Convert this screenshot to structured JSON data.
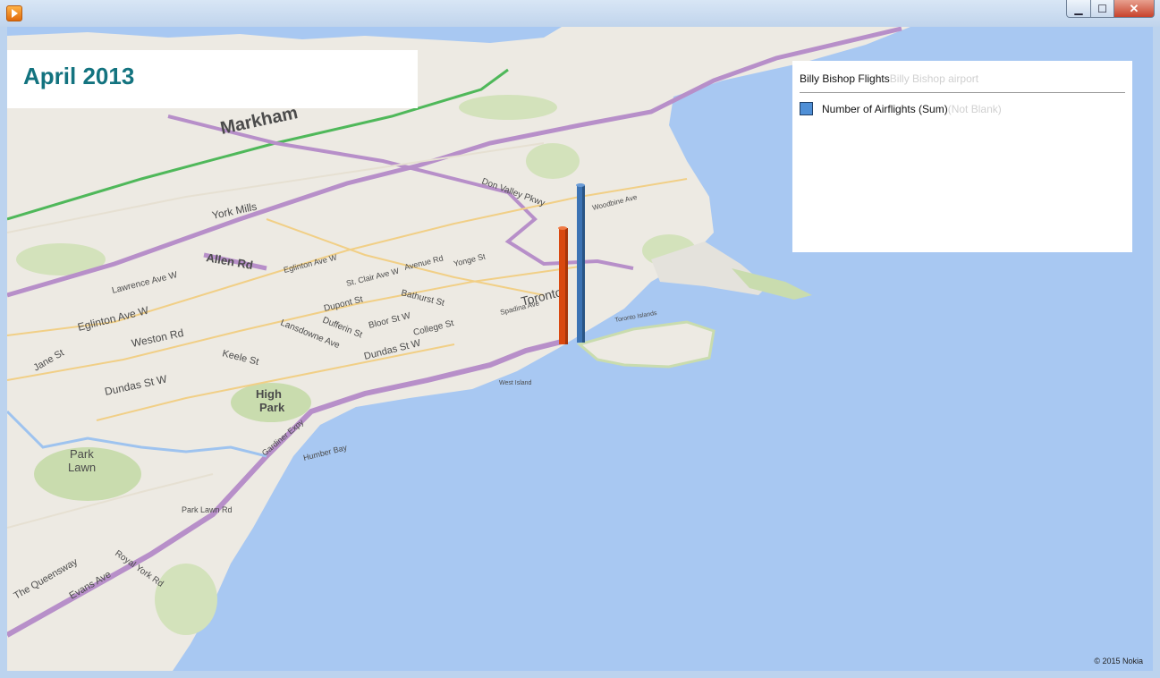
{
  "window": {
    "controls": {
      "minimize": "▁",
      "maximize": "☐",
      "close": "✕"
    }
  },
  "tour": {
    "title": "April 2013"
  },
  "legend": {
    "layer_name": "Billy Bishop Flights",
    "layer_ghost": "Billy Bishop airport",
    "items": [
      {
        "label": "Number of Airflights (Sum)",
        "ghost": "(Not Blank)",
        "color": "#4f8fd6"
      }
    ]
  },
  "map": {
    "copyright": "© 2015 Nokia",
    "colors": {
      "water": "#a8c8f2",
      "land": "#edeae3",
      "park": "#c9dcae",
      "highway": "#b78fc9",
      "arterial": "#f1cf86",
      "green_route": "#4fb85a"
    },
    "bars": [
      {
        "series": "orange",
        "color": "#d9480f"
      },
      {
        "series": "blue",
        "color": "#3c73b4"
      }
    ],
    "labels": {
      "markham": "Markham",
      "york_mills": "York Mills",
      "allen": "Allen Rd",
      "lawrence": "Lawrence Ave W",
      "eglinton_w": "Eglinton Ave W",
      "eglinton_e": "Eglinton Ave W",
      "weston": "Weston Rd",
      "keele": "Keele St",
      "jane": "Jane St",
      "dundas_w": "Dundas St W",
      "dundas_c": "Dundas St W",
      "high_park": "High",
      "high_park_2": "Park",
      "park_lawn": "Park",
      "park_lawn_2": "Lawn",
      "park_lawn_rd": "Park Lawn Rd",
      "queensway": "The Queensway",
      "royal_york": "Royal York Rd",
      "evans": "Evans Ave",
      "gardiner": "Gardiner Expy",
      "humber_bay": "Humber Bay",
      "toronto": "Toronto",
      "bloor": "Bloor St W",
      "college": "College St",
      "dupont": "Dupont St",
      "dufferin": "Dufferin St",
      "lansdowne": "Lansdowne Ave",
      "bathurst": "Bathurst St",
      "st_clair": "St. Clair Ave W",
      "avenue": "Avenue Rd",
      "yonge": "Yonge St",
      "spadina": "Spadina Ave",
      "toronto_islands": "Toronto Islands",
      "west_island": "West Island",
      "don_valley": "Don Valley Pkwy",
      "woodbine": "Woodbine Ave"
    }
  }
}
